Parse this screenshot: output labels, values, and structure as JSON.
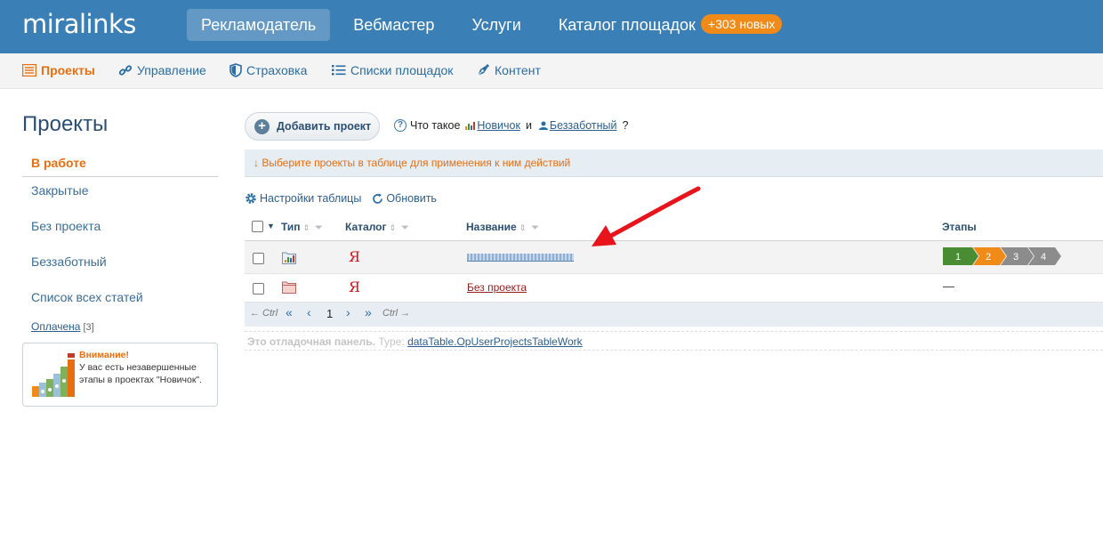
{
  "brand": {
    "logo": "miralinks"
  },
  "top_nav": [
    {
      "label": "Рекламодатель",
      "active": true
    },
    {
      "label": "Вебмастер",
      "active": false
    },
    {
      "label": "Услуги",
      "active": false
    },
    {
      "label": "Каталог площадок",
      "active": false,
      "badge": "+303 новых"
    }
  ],
  "sub_nav": [
    {
      "label": "Проекты",
      "icon": "list-icon",
      "active": true
    },
    {
      "label": "Управление",
      "icon": "link-icon",
      "active": false
    },
    {
      "label": "Страховка",
      "icon": "shield-icon",
      "active": false
    },
    {
      "label": "Списки площадок",
      "icon": "bulleted-list-icon",
      "active": false
    },
    {
      "label": "Контент",
      "icon": "pen-nib-icon",
      "active": false
    }
  ],
  "sidebar": {
    "title": "Проекты",
    "items": [
      {
        "label": "В работе",
        "active": true
      },
      {
        "label": "Закрытые",
        "active": false
      },
      {
        "label": "Без проекта",
        "active": false
      },
      {
        "label": "Беззаботный",
        "active": false
      },
      {
        "label": "Список всех статей",
        "active": false
      }
    ],
    "paid": {
      "label": "Оплачена",
      "count": "[3]"
    },
    "notice": {
      "title": "Внимание!",
      "text": "У вас есть незавершенные этапы в проектах \"Новичок\"."
    }
  },
  "toolbar": {
    "add_project": "Добавить проект",
    "what_is": "Что такое",
    "newbie": "Новичок",
    "and": "и",
    "carefree": "Беззаботный",
    "question_mark": "?"
  },
  "hint": "↓  Выберите проекты в таблице для применения к ним действий",
  "table_tools": {
    "settings": "Настройки таблицы",
    "refresh": "Обновить"
  },
  "table": {
    "columns": {
      "type": "Тип",
      "catalog": "Каталог",
      "name": "Название",
      "stages": "Этапы"
    },
    "rows": [
      {
        "type_icon": "chart-folder-icon",
        "catalog_icon": "yandex-icon",
        "catalog_glyph": "Я",
        "name": "",
        "stages": [
          "1",
          "2",
          "3",
          "4"
        ]
      },
      {
        "type_icon": "folder-icon",
        "catalog_icon": "yandex-icon",
        "catalog_glyph": "Я",
        "name": "Без проекта",
        "stages_text": "—"
      }
    ],
    "stage_colors": {
      "done": "#4a8c34",
      "current": "#f08a18",
      "pending": "#8c8c8c"
    }
  },
  "pager": {
    "prev_hint": "← Ctrl",
    "first": "«",
    "prev": "‹",
    "page": "1",
    "next": "›",
    "last": "»",
    "next_hint": "Ctrl →"
  },
  "debug": {
    "label": "Это отладочная панель.",
    "type_label": "Type:",
    "type_value": "dataTable.OpUserProjectsTableWork"
  },
  "colors": {
    "header": "#3a7fb5",
    "accent": "#e76f12",
    "link": "#2a6da3",
    "annotation_arrow": "#e8141b"
  }
}
